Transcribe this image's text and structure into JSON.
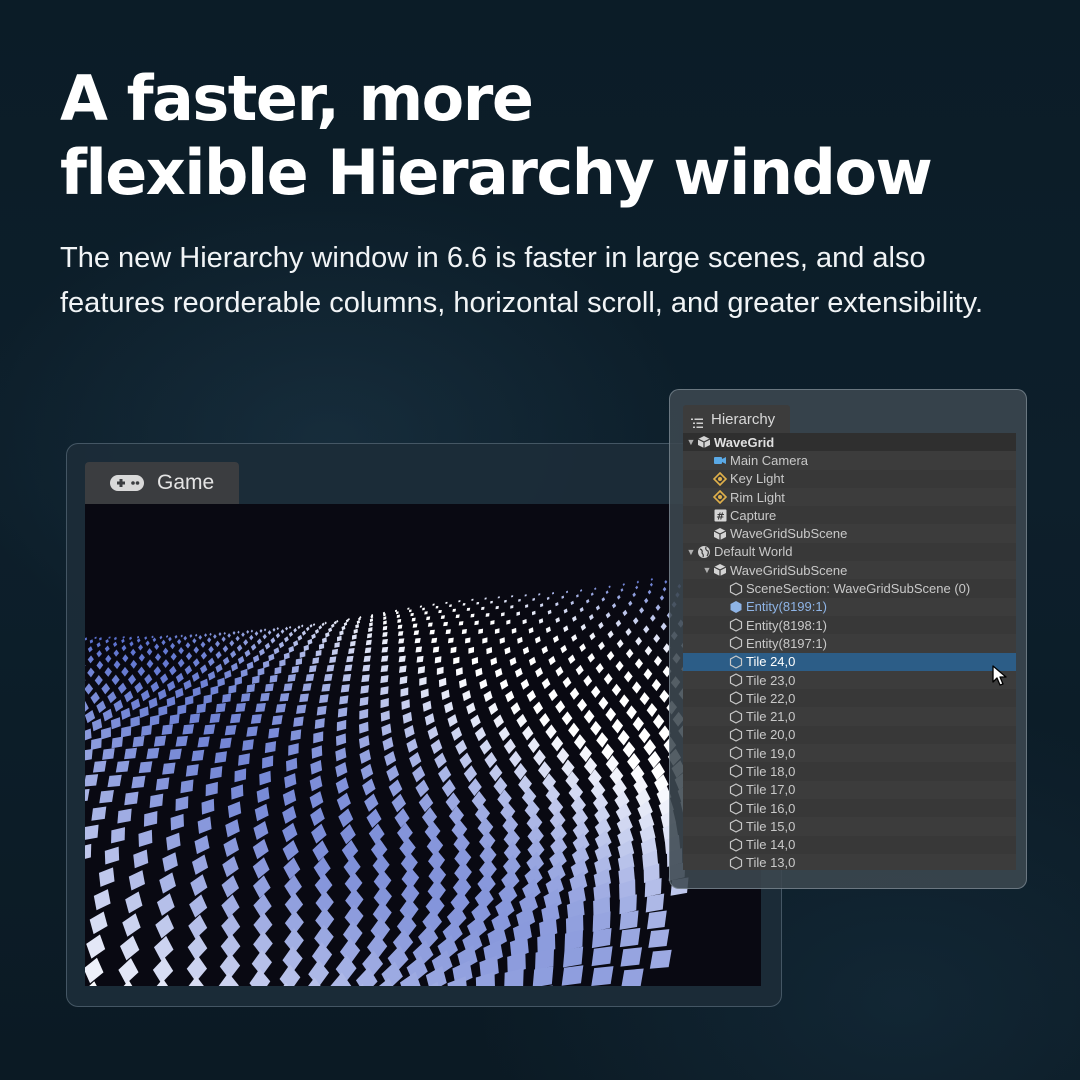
{
  "headline": {
    "line1": "A faster, more",
    "line2": "flexible Hierarchy window"
  },
  "description": "The new Hierarchy window in 6.6 is faster in large scenes, and also features reorderable columns, horizontal scroll, and greater extensibility.",
  "game_window": {
    "tab_label": "Game",
    "tab_icon": "gamepad-icon"
  },
  "hierarchy_window": {
    "tab_label": "Hierarchy",
    "tab_icon": "list-icon",
    "rows": [
      {
        "label": "WaveGrid",
        "icon": "unity-scene-icon",
        "depth": 0,
        "expanded": true,
        "style": "root"
      },
      {
        "label": "Main Camera",
        "icon": "camera-icon",
        "depth": 1
      },
      {
        "label": "Key Light",
        "icon": "light-icon",
        "depth": 1
      },
      {
        "label": "Rim Light",
        "icon": "light-icon",
        "depth": 1
      },
      {
        "label": "Capture",
        "icon": "script-icon",
        "depth": 1
      },
      {
        "label": "WaveGridSubScene",
        "icon": "subscene-icon",
        "depth": 1
      },
      {
        "label": "Default World",
        "icon": "globe-icon",
        "depth": 0,
        "expanded": true
      },
      {
        "label": "WaveGridSubScene",
        "icon": "subscene-icon",
        "depth": 1,
        "expanded": true
      },
      {
        "label": "SceneSection: WaveGridSubScene (0)",
        "icon": "entity-icon",
        "depth": 2
      },
      {
        "label": "Entity(8199:1)",
        "icon": "entity-filled-icon",
        "depth": 2,
        "style": "entity-active"
      },
      {
        "label": "Entity(8198:1)",
        "icon": "entity-icon",
        "depth": 2
      },
      {
        "label": "Entity(8197:1)",
        "icon": "entity-icon",
        "depth": 2
      },
      {
        "label": "Tile 24,0",
        "icon": "entity-icon",
        "depth": 2,
        "style": "selected"
      },
      {
        "label": "Tile 23,0",
        "icon": "entity-icon",
        "depth": 2
      },
      {
        "label": "Tile 22,0",
        "icon": "entity-icon",
        "depth": 2
      },
      {
        "label": "Tile 21,0",
        "icon": "entity-icon",
        "depth": 2
      },
      {
        "label": "Tile 20,0",
        "icon": "entity-icon",
        "depth": 2
      },
      {
        "label": "Tile 19,0",
        "icon": "entity-icon",
        "depth": 2
      },
      {
        "label": "Tile 18,0",
        "icon": "entity-icon",
        "depth": 2
      },
      {
        "label": "Tile 17,0",
        "icon": "entity-icon",
        "depth": 2
      },
      {
        "label": "Tile 16,0",
        "icon": "entity-icon",
        "depth": 2
      },
      {
        "label": "Tile 15,0",
        "icon": "entity-icon",
        "depth": 2
      },
      {
        "label": "Tile 14,0",
        "icon": "entity-icon",
        "depth": 2
      },
      {
        "label": "Tile 13,0",
        "icon": "entity-icon",
        "depth": 2
      }
    ]
  },
  "colors": {
    "background": "#0d1f2b",
    "selection": "#2c5d87",
    "camera_icon": "#5aa9e6",
    "light_icon": "#e0b04a",
    "entity_active": "#8eb4e6"
  }
}
